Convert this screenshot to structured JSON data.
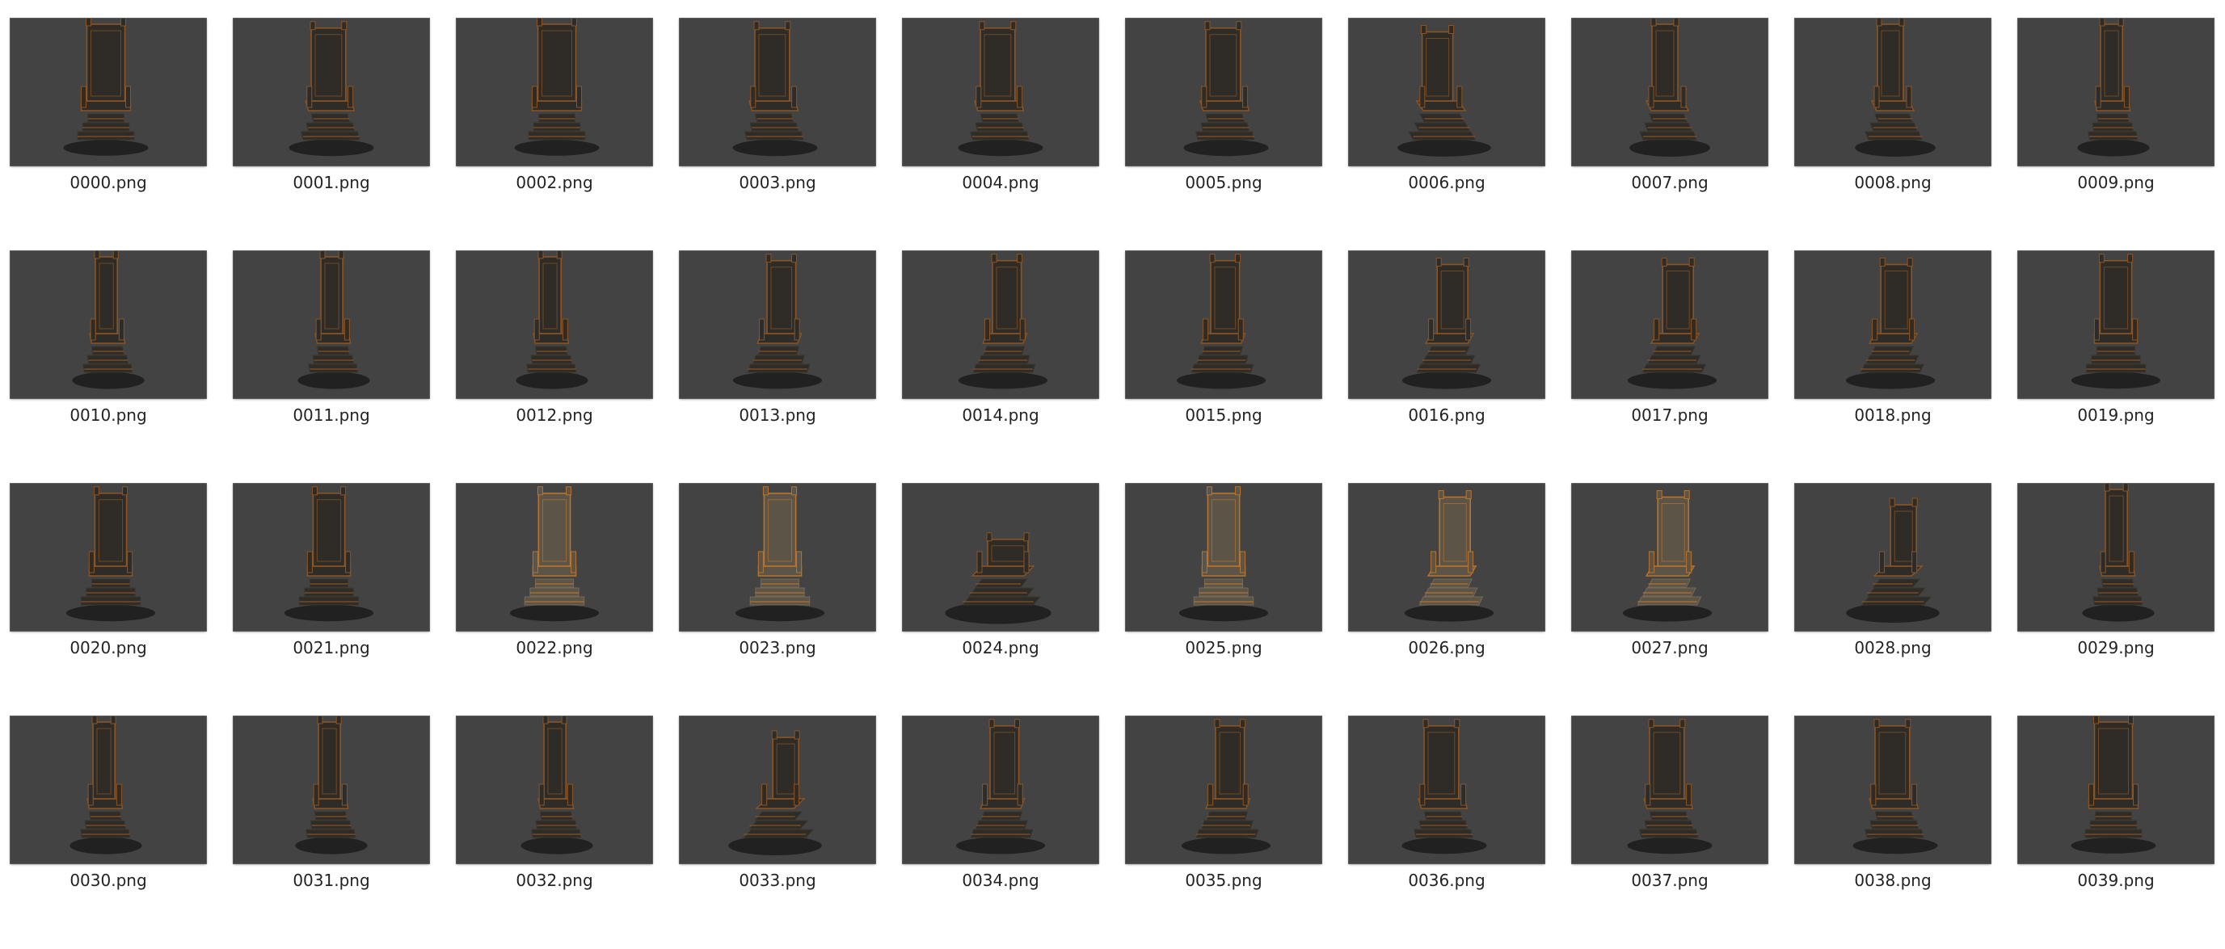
{
  "files": [
    {
      "name": "0000.png",
      "view": "front",
      "tone": "dark"
    },
    {
      "name": "0001.png",
      "view": "front-left",
      "tone": "dark"
    },
    {
      "name": "0002.png",
      "view": "front",
      "tone": "dark"
    },
    {
      "name": "0003.png",
      "view": "front-left",
      "tone": "dark"
    },
    {
      "name": "0004.png",
      "view": "front-left",
      "tone": "dark"
    },
    {
      "name": "0005.png",
      "view": "front-left",
      "tone": "dark"
    },
    {
      "name": "0006.png",
      "view": "left-angle",
      "tone": "dark"
    },
    {
      "name": "0007.png",
      "view": "left-side",
      "tone": "dark"
    },
    {
      "name": "0008.png",
      "view": "left-side",
      "tone": "dark"
    },
    {
      "name": "0009.png",
      "view": "side",
      "tone": "dark"
    },
    {
      "name": "0010.png",
      "view": "side",
      "tone": "dark"
    },
    {
      "name": "0011.png",
      "view": "side",
      "tone": "dark"
    },
    {
      "name": "0012.png",
      "view": "side",
      "tone": "dark"
    },
    {
      "name": "0013.png",
      "view": "three-quarter",
      "tone": "dark"
    },
    {
      "name": "0014.png",
      "view": "three-quarter",
      "tone": "dark"
    },
    {
      "name": "0015.png",
      "view": "three-quarter",
      "tone": "dark"
    },
    {
      "name": "0016.png",
      "view": "back-angle",
      "tone": "dark"
    },
    {
      "name": "0017.png",
      "view": "back-angle",
      "tone": "dark"
    },
    {
      "name": "0018.png",
      "view": "back-angle",
      "tone": "dark"
    },
    {
      "name": "0019.png",
      "view": "back",
      "tone": "dark"
    },
    {
      "name": "0020.png",
      "view": "back",
      "tone": "dark"
    },
    {
      "name": "0021.png",
      "view": "back",
      "tone": "dark"
    },
    {
      "name": "0022.png",
      "view": "back",
      "tone": "light"
    },
    {
      "name": "0023.png",
      "view": "back",
      "tone": "light"
    },
    {
      "name": "0024.png",
      "view": "top",
      "tone": "dark"
    },
    {
      "name": "0025.png",
      "view": "back",
      "tone": "light"
    },
    {
      "name": "0026.png",
      "view": "back-angle",
      "tone": "light"
    },
    {
      "name": "0027.png",
      "view": "back-angle",
      "tone": "light"
    },
    {
      "name": "0028.png",
      "view": "tilt",
      "tone": "dark"
    },
    {
      "name": "0029.png",
      "view": "side",
      "tone": "dark"
    },
    {
      "name": "0030.png",
      "view": "side",
      "tone": "dark"
    },
    {
      "name": "0031.png",
      "view": "side",
      "tone": "dark"
    },
    {
      "name": "0032.png",
      "view": "side",
      "tone": "dark"
    },
    {
      "name": "0033.png",
      "view": "tilt",
      "tone": "dark"
    },
    {
      "name": "0034.png",
      "view": "three-quarter",
      "tone": "dark"
    },
    {
      "name": "0035.png",
      "view": "three-quarter",
      "tone": "dark"
    },
    {
      "name": "0036.png",
      "view": "front-left",
      "tone": "dark"
    },
    {
      "name": "0037.png",
      "view": "front-left",
      "tone": "dark"
    },
    {
      "name": "0038.png",
      "view": "front-left",
      "tone": "dark"
    },
    {
      "name": "0039.png",
      "view": "front",
      "tone": "dark"
    }
  ],
  "colors": {
    "thumb_bg": "#434343",
    "stone": "#2f2c28",
    "stone_edge": "#3b3731",
    "rust": "#8a5424",
    "rust_light": "#b8742e",
    "shadow": "#161616",
    "label": "#232323"
  }
}
